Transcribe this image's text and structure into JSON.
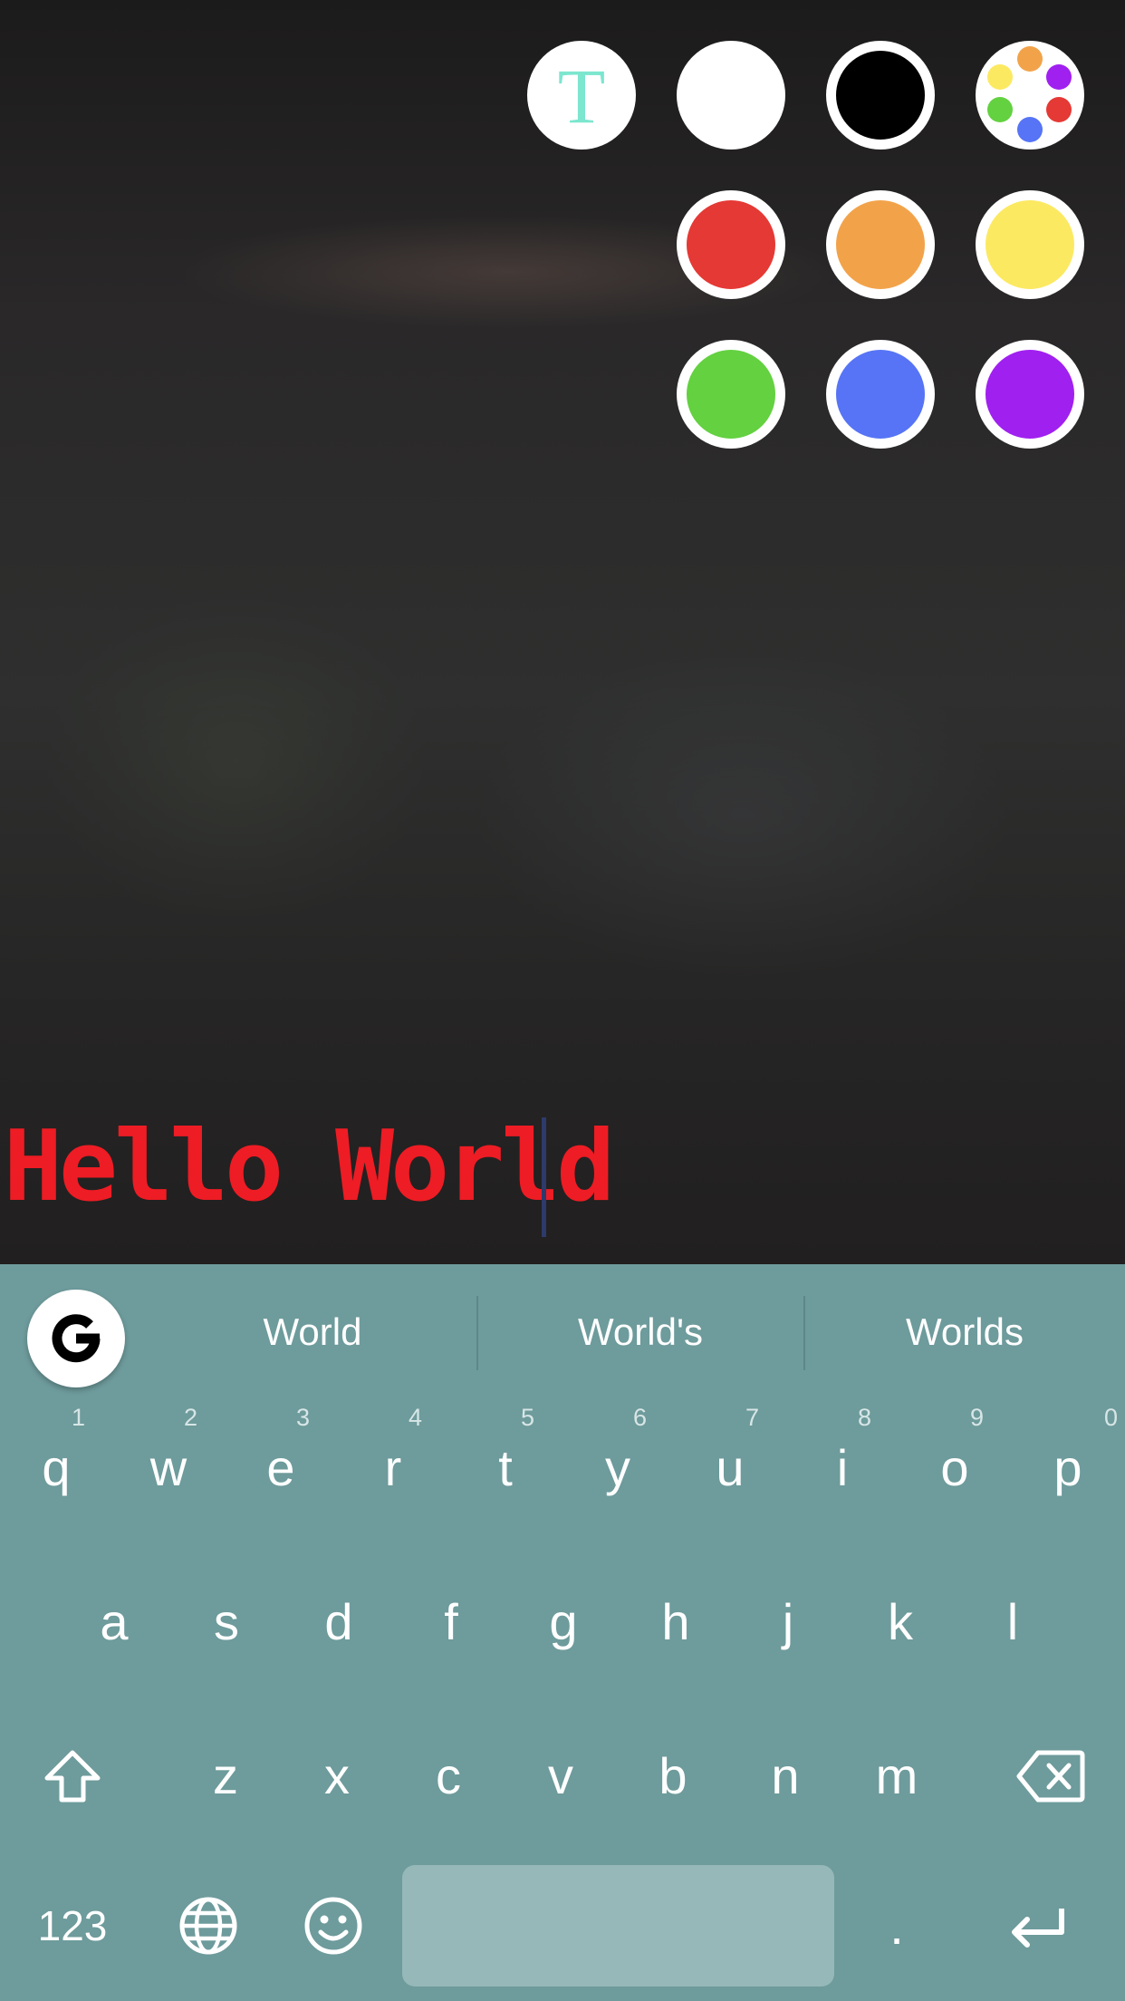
{
  "editor": {
    "text_style_glyph": "T",
    "typed_text": "Hello World",
    "text_color": "#ee1c24"
  },
  "palette": {
    "colors": [
      {
        "name": "white",
        "hex": "#ffffff"
      },
      {
        "name": "black",
        "hex": "#000000"
      },
      {
        "name": "red",
        "hex": "#e53935"
      },
      {
        "name": "orange",
        "hex": "#f2a34a"
      },
      {
        "name": "yellow",
        "hex": "#fce962"
      },
      {
        "name": "green",
        "hex": "#63d140"
      },
      {
        "name": "blue",
        "hex": "#5674f5"
      },
      {
        "name": "purple",
        "hex": "#a020f0"
      }
    ],
    "more_colors_icon": "color-palette-icon"
  },
  "keyboard": {
    "suggestions": [
      "World",
      "World's",
      "Worlds"
    ],
    "row1": [
      {
        "letter": "q",
        "hint": "1"
      },
      {
        "letter": "w",
        "hint": "2"
      },
      {
        "letter": "e",
        "hint": "3"
      },
      {
        "letter": "r",
        "hint": "4"
      },
      {
        "letter": "t",
        "hint": "5"
      },
      {
        "letter": "y",
        "hint": "6"
      },
      {
        "letter": "u",
        "hint": "7"
      },
      {
        "letter": "i",
        "hint": "8"
      },
      {
        "letter": "o",
        "hint": "9"
      },
      {
        "letter": "p",
        "hint": "0"
      }
    ],
    "row2": [
      "a",
      "s",
      "d",
      "f",
      "g",
      "h",
      "j",
      "k",
      "l"
    ],
    "row3": [
      "z",
      "x",
      "c",
      "v",
      "b",
      "n",
      "m"
    ],
    "numbers_label": "123",
    "period_label": ".",
    "background": "#6e9b9c"
  }
}
